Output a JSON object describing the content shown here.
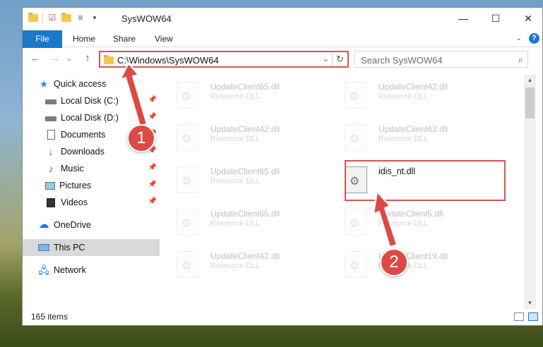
{
  "window": {
    "title": "SysWOW64",
    "controls": {
      "minimize": "—",
      "maximize": "☐",
      "close": "✕"
    }
  },
  "ribbon": {
    "tabs": [
      {
        "label": "File"
      },
      {
        "label": "Home"
      },
      {
        "label": "Share"
      },
      {
        "label": "View"
      }
    ]
  },
  "navbar": {
    "back": "←",
    "forward": "→",
    "recent": "⌄",
    "up": "↑",
    "address": "C:\\Windows\\SysWOW64",
    "refresh": "↻",
    "search_placeholder": "Search SysWOW64"
  },
  "sidebar": {
    "items": [
      {
        "label": "Quick access",
        "icon": "star-icon"
      },
      {
        "label": "Local Disk (C:)",
        "icon": "disk-icon",
        "pinned": true
      },
      {
        "label": "Local Disk (D:)",
        "icon": "disk-icon",
        "pinned": true
      },
      {
        "label": "Documents",
        "icon": "documents-icon",
        "pinned": true
      },
      {
        "label": "Downloads",
        "icon": "download-icon",
        "pinned": true
      },
      {
        "label": "Music",
        "icon": "music-icon",
        "pinned": true
      },
      {
        "label": "Pictures",
        "icon": "pictures-icon",
        "pinned": true
      },
      {
        "label": "Videos",
        "icon": "videos-icon",
        "pinned": true
      },
      {
        "label": "OneDrive",
        "icon": "cloud-icon"
      },
      {
        "label": "This PC",
        "icon": "computer-icon",
        "selected": true
      },
      {
        "label": "Network",
        "icon": "network-icon"
      }
    ]
  },
  "files": [
    {
      "name": "UpdateClient65.dll",
      "type": "Resource DLL"
    },
    {
      "name": "UpdateClient42.dll",
      "type": "Resource DLL"
    },
    {
      "name": "UpdateClient42.dll",
      "type": "Resource DLL"
    },
    {
      "name": "UpdateClient63.dll",
      "type": "Resource DLL"
    },
    {
      "name": "UpdateClient65.dll",
      "type": "Resource DLL"
    },
    {
      "name": "idis_nt.dll",
      "type": ""
    },
    {
      "name": "UpdateClient65.dll",
      "type": "Resource DLL"
    },
    {
      "name": "UpdateClient5.dll",
      "type": "Resource DLL"
    },
    {
      "name": "UpdateClient42.dll",
      "type": "Resource DLL"
    },
    {
      "name": "UpdateClient19.dll",
      "type": "Resource DLL"
    }
  ],
  "status": {
    "item_count": "165 items"
  },
  "annotations": {
    "step1": "1",
    "step2": "2"
  },
  "colors": {
    "accent": "#1979ca",
    "highlight": "#d9534f",
    "badge": "#dc4a45"
  }
}
